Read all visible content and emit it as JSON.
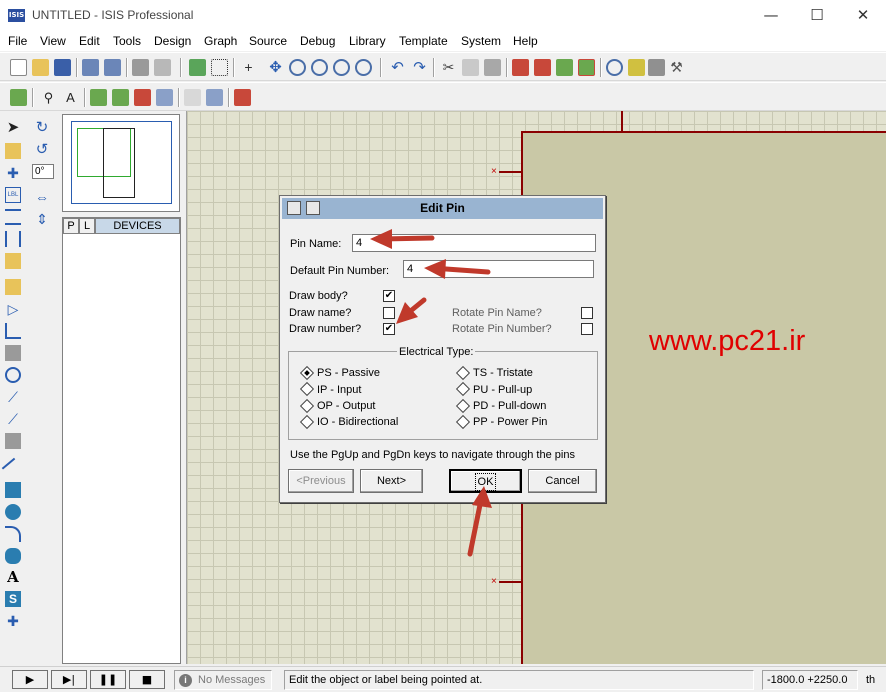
{
  "window": {
    "title": "UNTITLED - ISIS Professional",
    "app_icon": "ISIS",
    "minimize": "—",
    "maximize": "☐",
    "close": "✕"
  },
  "menu": [
    "File",
    "Edit",
    "View",
    "Tools",
    "Design",
    "Graph",
    "Source",
    "Debug",
    "Library",
    "Template",
    "System",
    "Help"
  ],
  "left_panel": {
    "rotation": "0°",
    "tab_p": "P",
    "tab_l": "L",
    "devices_header": "DEVICES"
  },
  "canvas": {
    "watermark": "www.pc21.ir",
    "pin_marker": "×"
  },
  "dialog": {
    "title": "Edit Pin",
    "pin_name_label": "Pin Name:",
    "pin_name_value": "4",
    "default_pin_number_label": "Default Pin Number:",
    "default_pin_number_value": "4",
    "draw_body_label": "Draw body?",
    "draw_body_checked": true,
    "draw_name_label": "Draw name?",
    "draw_name_checked": false,
    "draw_number_label": "Draw number?",
    "draw_number_checked": true,
    "rotate_pin_name_label": "Rotate Pin Name?",
    "rotate_pin_name_checked": false,
    "rotate_pin_number_label": "Rotate Pin Number?",
    "rotate_pin_number_checked": false,
    "electrical_type_label": "Electrical Type:",
    "types": [
      {
        "label": "PS - Passive",
        "selected": true
      },
      {
        "label": "IP - Input",
        "selected": false
      },
      {
        "label": "OP - Output",
        "selected": false
      },
      {
        "label": "IO - Bidirectional",
        "selected": false
      },
      {
        "label": "TS - Tristate",
        "selected": false
      },
      {
        "label": "PU - Pull-up",
        "selected": false
      },
      {
        "label": "PD - Pull-down",
        "selected": false
      },
      {
        "label": "PP - Power Pin",
        "selected": false
      }
    ],
    "hint": "Use the PgUp and PgDn keys to navigate through the pins",
    "previous_button": "<Previous",
    "next_button": "Next>",
    "ok_button": "OK",
    "cancel_button": "Cancel",
    "check_mark": "✔"
  },
  "statusbar": {
    "play": "▶",
    "step": "▶|",
    "pause": "❚❚",
    "stop": "■",
    "info_icon": "i",
    "messages": "No Messages",
    "status_text": "Edit the object or label being pointed at.",
    "coords": "-1800.0  +2250.0",
    "units": "th"
  },
  "colors": {
    "canvas_bg": "#e2e2cf",
    "component_fill": "#c9c8a6",
    "component_border": "#8a0000",
    "dialog_title_bg": "#99b4d1",
    "watermark": "#e00000",
    "annotation_arrow": "#c0392b"
  }
}
